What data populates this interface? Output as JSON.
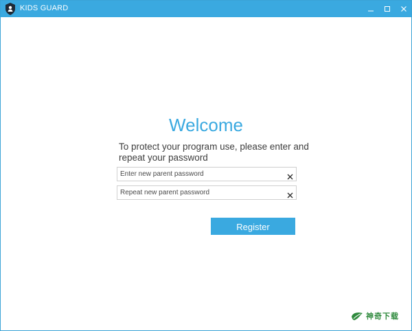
{
  "window": {
    "title": "KIDS GUARD",
    "accent_color": "#3aa9e0",
    "controls": {
      "minimize_icon": "minimize-icon",
      "maximize_icon": "maximize-icon",
      "close_icon": "close-icon"
    }
  },
  "main": {
    "heading": "Welcome",
    "instructions": "To protect your program use, please enter and repeat your password",
    "fields": [
      {
        "placeholder": "Enter new parent password",
        "value": "",
        "clear_icon": "clear-icon"
      },
      {
        "placeholder": "Repeat new parent password",
        "value": "",
        "clear_icon": "clear-icon"
      }
    ],
    "register_label": "Register"
  },
  "watermark": {
    "text": "神奇下载",
    "icon": "leaf-logo-icon",
    "color": "#2f8a3d"
  }
}
